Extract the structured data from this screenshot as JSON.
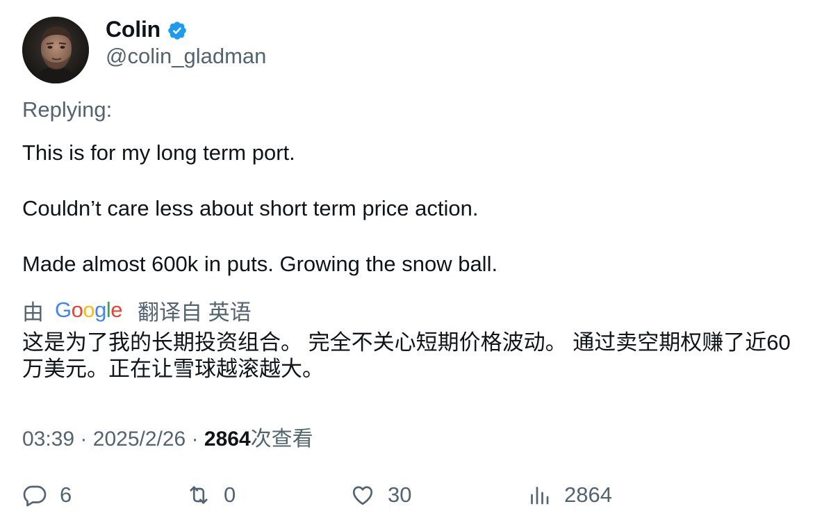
{
  "author": {
    "display_name": "Colin",
    "handle": "@colin_gladman",
    "avatar_icon": "avatar",
    "verified_icon": "verified-badge-icon",
    "verified_color": "#1d9bf0"
  },
  "replying_label": "Replying:",
  "tweet": {
    "lines": [
      "This is for my long term port.",
      "Couldn’t care less about short term price action.",
      "Made almost 600k in puts. Growing the snow ball."
    ]
  },
  "translation": {
    "by_label": "由",
    "provider": "Google",
    "from_label": "翻译自 英语",
    "text": "这是为了我的长期投资组合。 完全不关心短期价格波动。 通过卖空期权赚了近60万美元。正在让雪球越滚越大。"
  },
  "meta": {
    "time": "03:39",
    "date": "2025/2/26",
    "views_count": "2864",
    "views_label": "次查看",
    "separator": "·"
  },
  "actions": {
    "replies": "6",
    "reposts": "0",
    "likes": "30",
    "views": "2864"
  },
  "colors": {
    "text_primary": "#0f1419",
    "text_secondary": "#536471"
  }
}
